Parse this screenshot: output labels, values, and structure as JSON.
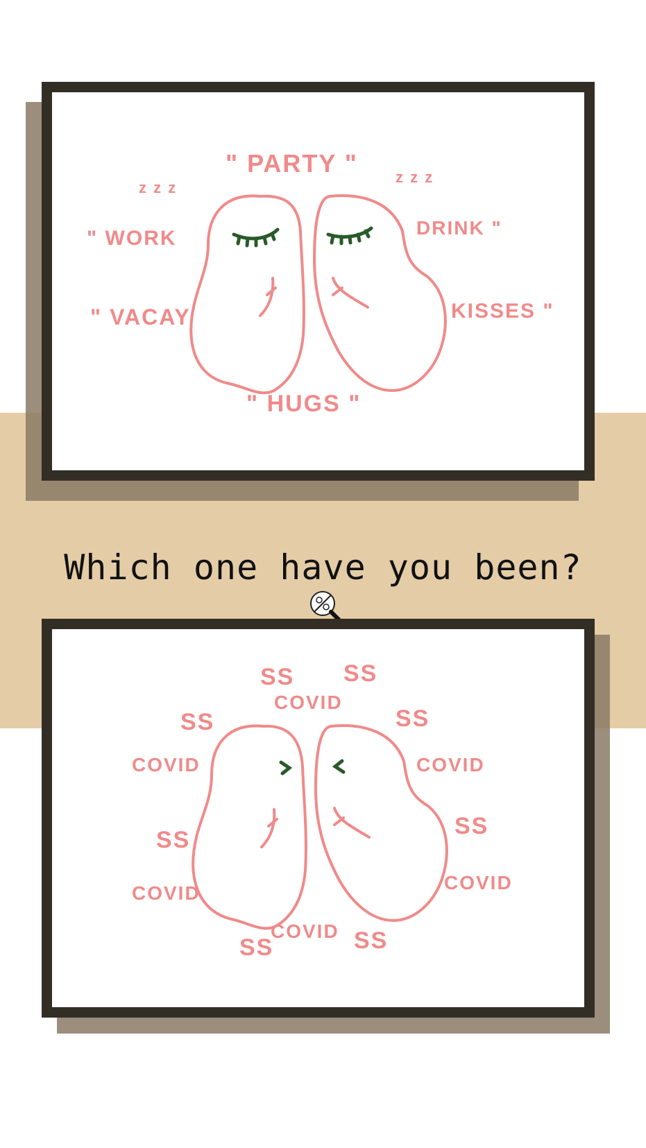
{
  "caption": "Which one have you been?",
  "colors": {
    "band": "#e4cca6",
    "frame_border": "#332e25",
    "shadow": "#8a7a65",
    "lung_outline": "#f08a8a",
    "eye_marks": "#2a5a2a"
  },
  "top_panel": {
    "words": {
      "party": "\" PARTY \"",
      "work": "\" WORK",
      "drink": "DRINK \"",
      "vacay": "\" VACAY",
      "kisses": "KISSES \"",
      "hugs": "\" HUGS \"",
      "snore_left": "z z z",
      "snore_right": "z z z"
    }
  },
  "bottom_panel": {
    "covid_label": "COVID",
    "ss_label": "SS"
  },
  "cursor_icon": "magnifier-cursor-icon"
}
